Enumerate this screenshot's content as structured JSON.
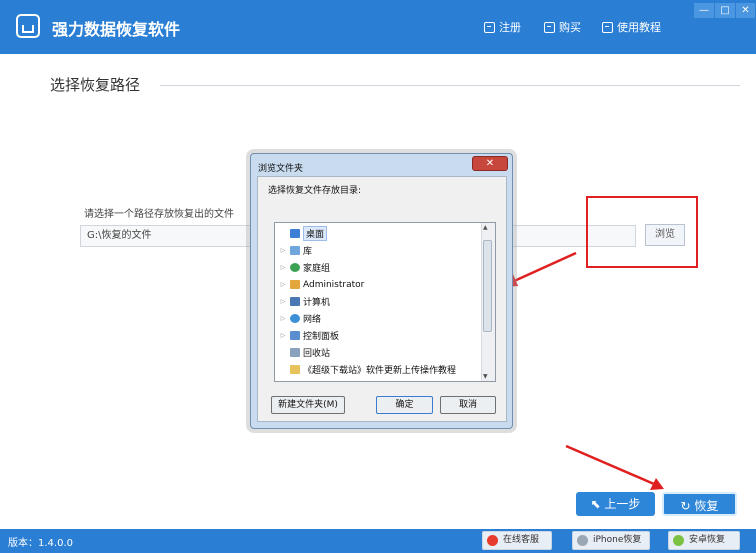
{
  "app": {
    "title": "强力数据恢复软件",
    "register": "注册",
    "buy": "购买",
    "tutorial": "使用教程",
    "minimize": "—",
    "maximize": "□",
    "close": "✕"
  },
  "main": {
    "section_title": "选择恢复路径",
    "path_hint": "请选择一个路径存放恢复出的文件",
    "path_value": "G:\\恢复的文件",
    "browse_label": "浏览",
    "prev_label": "上一步",
    "restore_label": "恢复"
  },
  "dialog": {
    "title": "浏览文件夹",
    "prompt": "选择恢复文件存放目录:",
    "tree": [
      {
        "label": "桌面",
        "expander": "",
        "icon": "desktop-icon",
        "color": "#3d7fd6",
        "selected": true
      },
      {
        "label": "库",
        "expander": "▷",
        "icon": "library-icon",
        "color": "#6fa6de"
      },
      {
        "label": "家庭组",
        "expander": "▷",
        "icon": "homegroup-icon",
        "color": "#3aa152"
      },
      {
        "label": "Administrator",
        "expander": "▷",
        "icon": "user-folder-icon",
        "color": "#e2a63a"
      },
      {
        "label": "计算机",
        "expander": "▷",
        "icon": "computer-icon",
        "color": "#4a78b5"
      },
      {
        "label": "网络",
        "expander": "▷",
        "icon": "network-icon",
        "color": "#3d8fd6"
      },
      {
        "label": "控制面板",
        "expander": "▷",
        "icon": "control-panel-icon",
        "color": "#5b8ed0"
      },
      {
        "label": "回收站",
        "expander": "",
        "icon": "recycle-bin-icon",
        "color": "#8aa2bd"
      },
      {
        "label": "《超级下载站》软件更新上传操作教程",
        "expander": "",
        "icon": "folder-icon",
        "color": "#e8c25a"
      }
    ],
    "new_folder": "新建文件夹(M)",
    "ok": "确定",
    "cancel": "取消"
  },
  "footer": {
    "version": "版本：1.4.0.0",
    "online_service": "在线客服",
    "iphone_restore": "iPhone恢复",
    "android_restore": "安卓恢复"
  },
  "colors": {
    "brand": "#2a7fd4",
    "annotation": "#e02020"
  }
}
